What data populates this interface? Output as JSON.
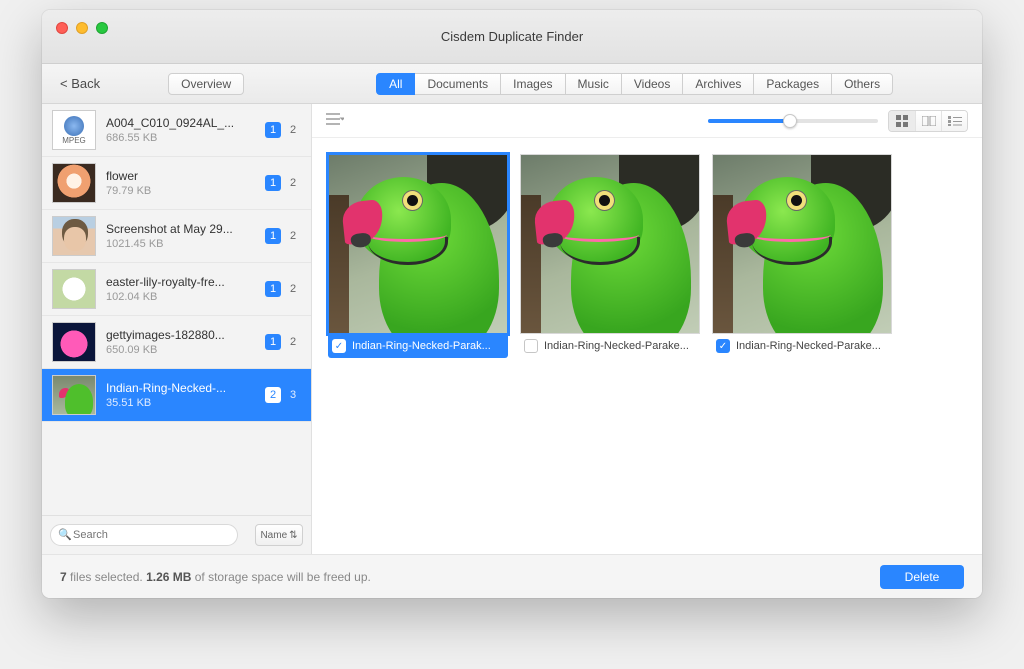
{
  "window": {
    "title": "Cisdem Duplicate Finder"
  },
  "toolbar": {
    "back": "< Back",
    "overview": "Overview",
    "tabs": [
      "All",
      "Documents",
      "Images",
      "Music",
      "Videos",
      "Archives",
      "Packages",
      "Others"
    ],
    "active_tab": 0
  },
  "sidebar": {
    "search_placeholder": "Search",
    "sort_label": "Name",
    "items": [
      {
        "name": "A004_C010_0924AL_...",
        "size": "686.55 KB",
        "sel": 1,
        "tot": 2,
        "thumb": "mov"
      },
      {
        "name": "flower",
        "size": "79.79 KB",
        "sel": 1,
        "tot": 2,
        "thumb": "flower1"
      },
      {
        "name": "Screenshot at May 29...",
        "size": "1021.45 KB",
        "sel": 1,
        "tot": 2,
        "thumb": "face"
      },
      {
        "name": "easter-lily-royalty-fre...",
        "size": "102.04 KB",
        "sel": 1,
        "tot": 2,
        "thumb": "lily"
      },
      {
        "name": "gettyimages-182880...",
        "size": "650.09 KB",
        "sel": 1,
        "tot": 2,
        "thumb": "lotus"
      },
      {
        "name": "Indian-Ring-Necked-...",
        "size": "35.51 KB",
        "sel": 2,
        "tot": 3,
        "thumb": "parakeet",
        "selected": true
      }
    ]
  },
  "grid": {
    "items": [
      {
        "name": "Indian-Ring-Necked-Parak...",
        "checked": true,
        "selected": true
      },
      {
        "name": "Indian-Ring-Necked-Parake...",
        "checked": false,
        "selected": false
      },
      {
        "name": "Indian-Ring-Necked-Parake...",
        "checked": true,
        "selected": false
      }
    ]
  },
  "status": {
    "count": "7",
    "mid1": " files selected. ",
    "size": "1.26 MB",
    "mid2": " of storage space will be freed up.",
    "delete": "Delete"
  }
}
